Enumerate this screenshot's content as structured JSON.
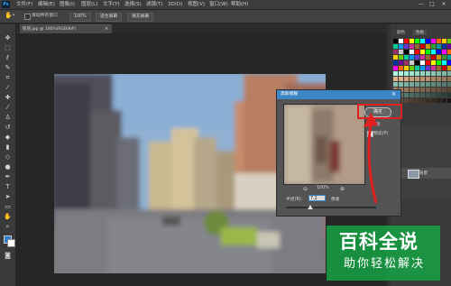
{
  "app": {
    "logo": "Ps"
  },
  "menu": {
    "items": [
      "文件(F)",
      "编辑(E)",
      "图像(I)",
      "图层(L)",
      "文字(Y)",
      "选择(S)",
      "滤镜(T)",
      "3D(D)",
      "视图(V)",
      "窗口(W)",
      "帮助(H)"
    ],
    "window_controls": [
      "—",
      "□",
      "✕"
    ]
  },
  "options": {
    "auto_scroll_label": "滚动所有窗口",
    "zoom_value": "100%",
    "fit_screen_label": "适合屏幕",
    "fill_screen_label": "填充屏幕"
  },
  "document": {
    "tab_label": "街道.jpg @ 100%(RGB/8#)",
    "close": "×"
  },
  "tools": [
    "move-icon",
    "marquee-icon",
    "lasso-icon",
    "quick-select-icon",
    "crop-icon",
    "eyedropper-icon",
    "healing-brush-icon",
    "brush-icon",
    "stamp-icon",
    "history-brush-icon",
    "eraser-icon",
    "gradient-icon",
    "blur-icon",
    "dodge-icon",
    "pen-icon",
    "type-icon",
    "path-select-icon",
    "rectangle-icon",
    "hand-icon",
    "zoom-icon"
  ],
  "dialog": {
    "title": "高斯模糊",
    "close": "✕",
    "ok_label": "确定",
    "cancel_label": "取消",
    "preview_label": "预览(P)",
    "preview_checked": true,
    "zoom_out": "⊖",
    "zoom_value": "100%",
    "zoom_in": "⊕",
    "radius_label": "半径(R):",
    "radius_value": "7.2",
    "radius_unit": "像素"
  },
  "panels": {
    "tabs": [
      "颜色",
      "色板"
    ],
    "layer_name": "背景"
  },
  "annotation_color": "#e02020",
  "watermark": {
    "line1": "百科全说",
    "line2": "助你轻松解决",
    "color": "#14aa46"
  }
}
